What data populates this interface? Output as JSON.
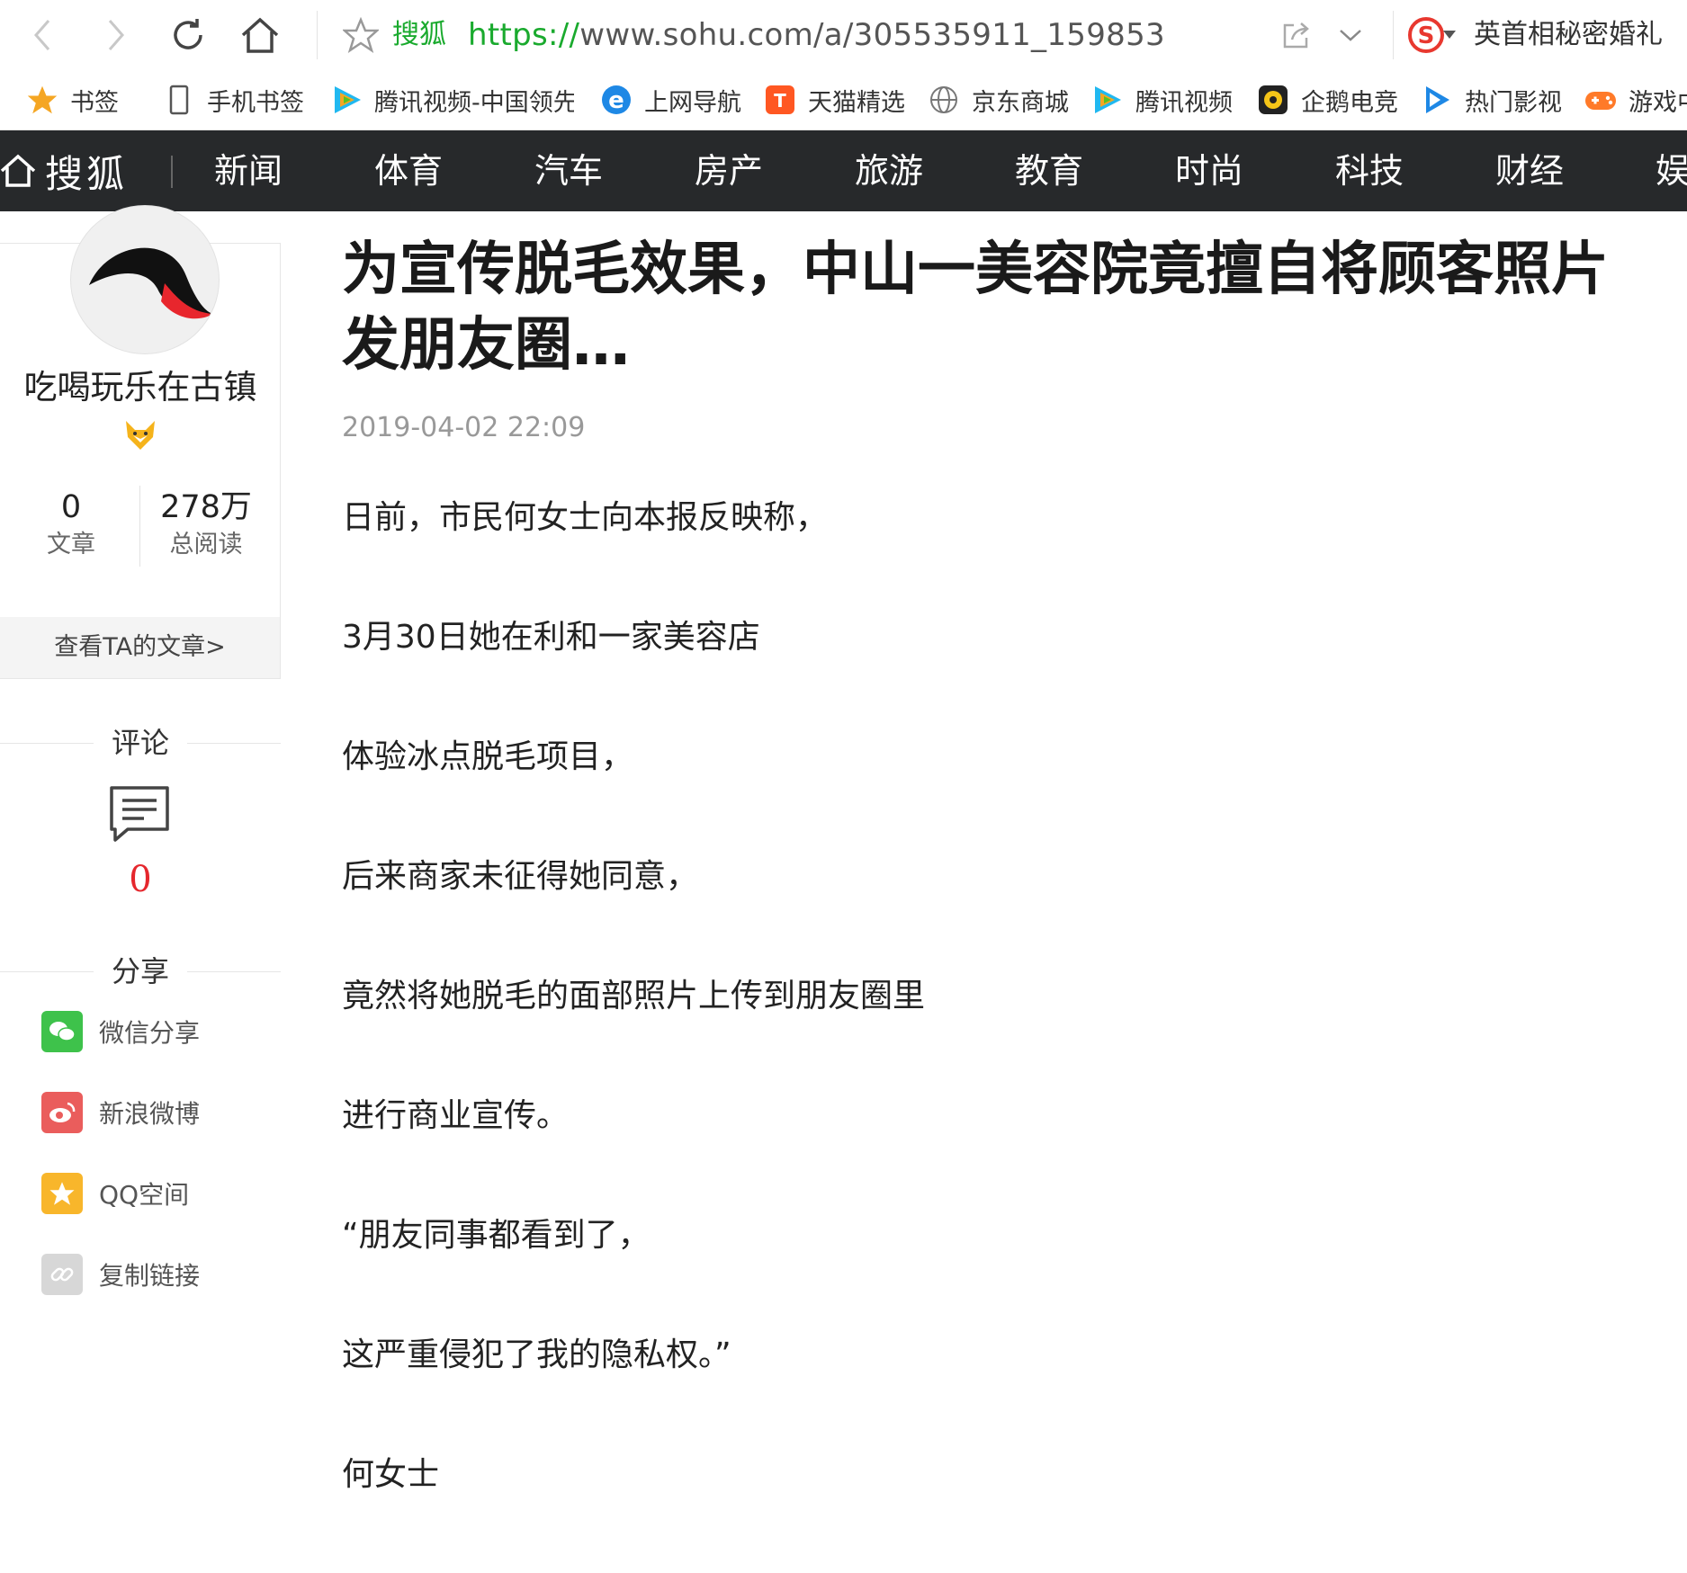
{
  "browser": {
    "url_site_label": "搜狐",
    "url_protocol": "https://",
    "url_rest": "www.sohu.com/a/305535911_159853",
    "search_text": "英首相秘密婚礼"
  },
  "bookmarks": [
    {
      "label": "书签",
      "icon": "star-icon"
    },
    {
      "label": "手机书签",
      "icon": "phone-icon"
    },
    {
      "label": "腾讯视频-中国领先",
      "icon": "tencent-video-icon"
    },
    {
      "label": "上网导航",
      "icon": "ie-icon"
    },
    {
      "label": "天猫精选",
      "icon": "tmall-icon"
    },
    {
      "label": "京东商城",
      "icon": "globe-icon"
    },
    {
      "label": "腾讯视频",
      "icon": "tencent-video-icon"
    },
    {
      "label": "企鹅电竞",
      "icon": "penguin-esports-icon"
    },
    {
      "label": "热门影视",
      "icon": "play-icon"
    },
    {
      "label": "游戏中",
      "icon": "gamepad-icon"
    }
  ],
  "nav": {
    "logo": "搜狐",
    "items": [
      "新闻",
      "体育",
      "汽车",
      "房产",
      "旅游",
      "教育",
      "时尚",
      "科技",
      "财经",
      "娱"
    ]
  },
  "author": {
    "name": "吃喝玩乐在古镇",
    "articles_count": "0",
    "articles_label": "文章",
    "reads_count": "278万",
    "reads_label": "总阅读",
    "view_link": "查看TA的文章>"
  },
  "comments": {
    "heading": "评论",
    "count": "0"
  },
  "share": {
    "heading": "分享",
    "items": [
      {
        "label": "微信分享",
        "icon": "wechat-icon",
        "color": "#3ec24b"
      },
      {
        "label": "新浪微博",
        "icon": "weibo-icon",
        "color": "#ea5d5c"
      },
      {
        "label": "QQ空间",
        "icon": "qzone-icon",
        "color": "#f8b62b"
      },
      {
        "label": "复制链接",
        "icon": "link-icon",
        "color": "#d7d7d7"
      }
    ]
  },
  "article": {
    "title": "为宣传脱毛效果，中山一美容院竟擅自将顾客照片发朋友圈…",
    "time": "2019-04-02 22:09",
    "paragraphs": [
      "日前，市民何女士向本报反映称，",
      "3月30日她在利和一家美容店",
      "体验冰点脱毛项目，",
      "后来商家未征得她同意，",
      "竟然将她脱毛的面部照片上传到朋友圈里",
      "进行商业宣传。",
      "“朋友同事都看到了，",
      "这严重侵犯了我的隐私权。”",
      "何女士"
    ]
  },
  "colors": {
    "nav_bg": "#27292b",
    "accent_red": "#e5272d",
    "url_green": "#1aaa2e"
  }
}
